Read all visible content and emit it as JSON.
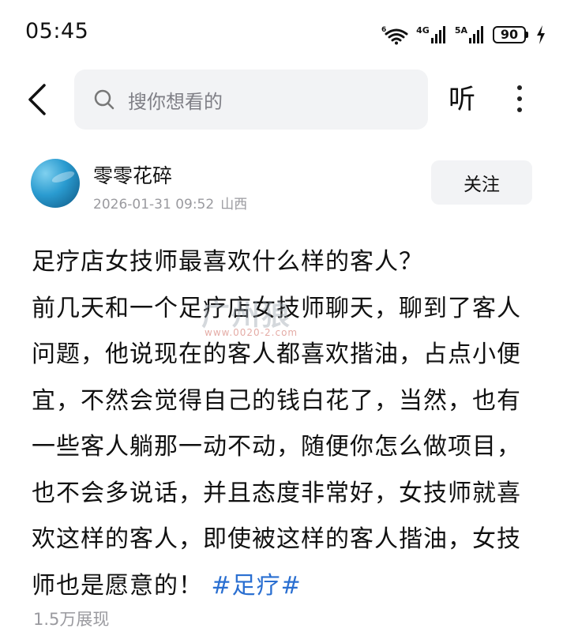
{
  "status_bar": {
    "time": "05:45",
    "signal_1": "4G",
    "signal_2": "5A",
    "battery": "90"
  },
  "nav": {
    "search_placeholder": "搜你想看的",
    "listen_label": "听"
  },
  "author": {
    "name": "零零花碎",
    "datetime": "2026-01-31 09:52",
    "location": "山西",
    "follow_label": "关注"
  },
  "post": {
    "title": "足疗店女技师最喜欢什么样的客人？",
    "body": "前几天和一个足疗店女技师聊天，聊到了客人问题，他说现在的客人都喜欢揩油，占点小便宜，不然会觉得自己的钱白花了，当然，也有一些客人躺那一动不动，随便你怎么做项目，也不会多说话，并且态度非常好，女技师就喜欢这样的客人，即使被这样的客人揩油，女技师也是愿意的！",
    "hashtag": "#足疗#",
    "views": "1.5万展现"
  },
  "watermark": {
    "text": "广州狼",
    "url": "www.0020-2.com"
  },
  "colors": {
    "background": "#ffffff",
    "search_bg": "#f2f3f5",
    "meta_text": "#9a9a9f",
    "hashtag": "#2a6fd1"
  },
  "icons": [
    "wifi-6-icon",
    "signal-icon",
    "battery-icon",
    "charging-icon",
    "back-arrow-icon",
    "search-icon",
    "more-vertical-icon"
  ]
}
